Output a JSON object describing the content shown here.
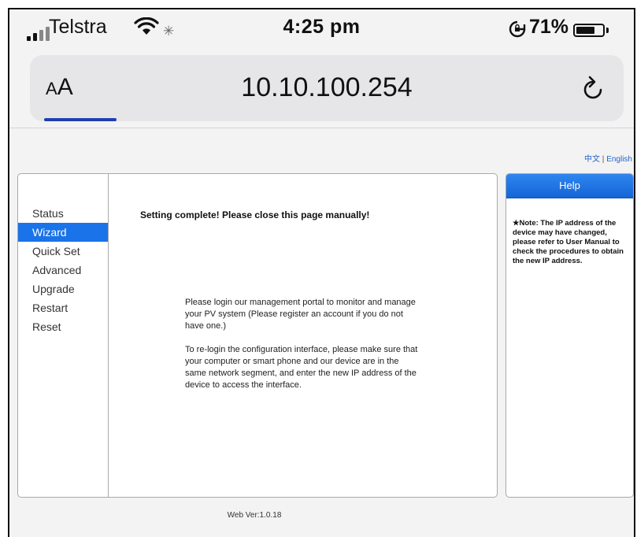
{
  "status_bar": {
    "carrier": "Telstra",
    "time": "4:25 pm",
    "battery": "71%",
    "battery_level": 0.71
  },
  "browser": {
    "text_size_button": "AA",
    "url": "10.10.100.254",
    "load_progress": 0.12
  },
  "page": {
    "language": {
      "chinese": "中文",
      "separator": "|",
      "english": "English"
    },
    "sidebar": {
      "items": [
        {
          "label": "Status"
        },
        {
          "label": "Wizard",
          "active": true
        },
        {
          "label": "Quick Set"
        },
        {
          "label": "Advanced"
        },
        {
          "label": "Upgrade"
        },
        {
          "label": "Restart"
        },
        {
          "label": "Reset"
        }
      ]
    },
    "main": {
      "heading": "Setting complete! Please close this page manually!",
      "paragraph_1": "Please login our management portal to monitor and manage your PV system (Please register an account if you do not have one.)",
      "paragraph_2": "To re-login the configuration interface, please make sure that your computer or smart phone and our device are in the same network segment, and enter the new IP address of the device to access the interface."
    },
    "help": {
      "title": "Help",
      "note": "★Note: The IP address of the device may have changed, please refer to User Manual to check the procedures to obtain the new IP address."
    },
    "footer": {
      "version": "Web Ver:1.0.18"
    }
  },
  "colors": {
    "accent": "#1a73e8",
    "progress": "#1f3fb0"
  }
}
